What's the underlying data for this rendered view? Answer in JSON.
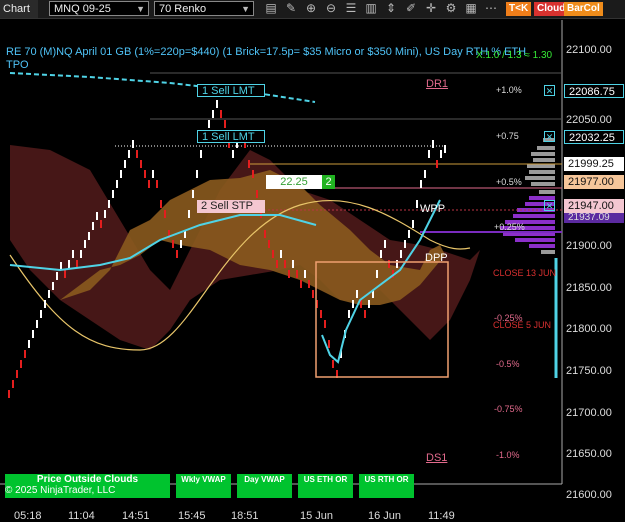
{
  "toolbar": {
    "tab_label": "Chart",
    "instrument": "MNQ 09-25",
    "period": "70 Renko",
    "buttons": [
      {
        "label": "T<K",
        "color": "#f07e1a"
      },
      {
        "label": "Cloud",
        "color": "#d8322f"
      },
      {
        "label": "BarCol",
        "color": "#ef8c1b"
      }
    ],
    "icons": [
      "bar-style-icon",
      "drawing-tools-icon",
      "zoom-in-icon",
      "zoom-out-icon",
      "list-icon",
      "stats-icon",
      "scale-icon",
      "pencil-icon",
      "crosshair-icon",
      "properties-icon",
      "template-icon",
      "more-icon"
    ]
  },
  "chart": {
    "title": "RE 70 (M)NQ April 01 GB (1%=220p=$440) (1 Brick=17.5p= $35 Micro or $350 Mini), US Day RTH % ETH",
    "subtitle": "TPO",
    "top_right": "X:1.0 / 1.3 ≈ 1.30",
    "colors": {
      "bull": "#ffffff",
      "bear": "#e41e1e",
      "cloud_bull": "#8a5a1e",
      "cloud_bear": "#4a1818",
      "cyan_line": "#4fd3e6",
      "yellow_line": "#e8c56a"
    }
  },
  "orders": [
    {
      "label": "1  Sell LMT",
      "price": "22086.75",
      "pct": "+1.0%"
    },
    {
      "label": "1  Sell LMT",
      "price": "22032.25",
      "pct": "+0.75"
    },
    {
      "label": "2  Sell STP",
      "price": "21947.00"
    }
  ],
  "position": {
    "avg_price": "22.25",
    "qty": "2"
  },
  "levels": {
    "dr1": "DR1",
    "wpp": "WPP",
    "dpp": "DPP",
    "ds1": "DS1",
    "close13": "CLOSE 13 JUN",
    "close5": "CLOSE 5 JUN"
  },
  "pct_labels": [
    "+0.5%",
    "+0.25%",
    "-0.25%",
    "-0.5%",
    "-0.75%",
    "-1.0%"
  ],
  "price_labels": {
    "p1": "21999.25",
    "p2": "21977.00",
    "p3": "21937.09"
  },
  "y_axis": [
    "22100.00",
    "22050.00",
    "21900.00",
    "21850.00",
    "21800.00",
    "21750.00",
    "21700.00",
    "21650.00",
    "21600.00"
  ],
  "x_axis": [
    "05:18",
    "11:04",
    "14:51",
    "15:45",
    "18:51",
    "15 Jun",
    "16 Jun",
    "11:49"
  ],
  "bottom_buttons": {
    "price_outside": "Price Outside Clouds",
    "copyright": "© 2025 NinjaTrader, LLC",
    "wkly_vwap": "Wkly VWAP",
    "day_vwap": "Day VWAP",
    "us_eth_or": "US ETH OR",
    "us_rth_or": "US RTH OR"
  }
}
